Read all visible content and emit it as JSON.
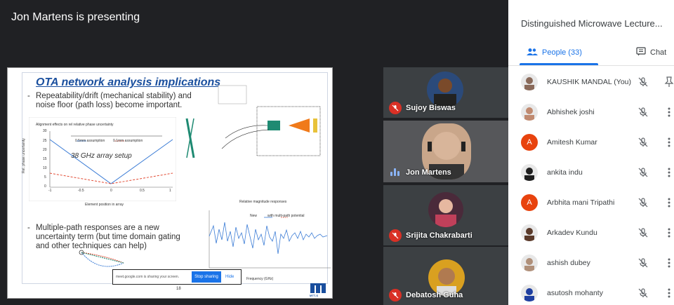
{
  "stage": {
    "presenting_label": "Jon Martens is presenting"
  },
  "slide": {
    "title": "OTA network analysis implications",
    "bullet1": "Repeatability/drift (mechanical stability) and noise floor (path loss) become important.",
    "bullet2": "Multiple-path responses are a new uncertainty term (but time domain gating and other techniques can help)",
    "chart1": {
      "title": "Alignment effects on rel relative phase uncertainty",
      "overlay": "38 GHz array setup",
      "legend_solid": "0.5mm assumption",
      "legend_dashed": "0.1mm assumption",
      "ylabel": "Rel. phase uncertainty",
      "xlabel": "Element position in array",
      "yticks": [
        "30",
        "25",
        "20",
        "15",
        "10",
        "5",
        "0"
      ],
      "xticks": [
        "-1",
        "-0.5",
        "0",
        "0.5",
        "1"
      ]
    },
    "chart2": {
      "title": "Relative magnitude responses",
      "legend_new": "New",
      "legend_mp": "with multi-path potential",
      "xlabel": "Frequency (GHz)"
    },
    "page_number": "18",
    "logo_text": "MTT-S"
  },
  "sharebar": {
    "message": "meet.google.com is sharing your screen.",
    "stop_label": "Stop sharing",
    "hide_label": "Hide"
  },
  "tiles": [
    {
      "name": "Sujoy Biswas",
      "muted": true
    },
    {
      "name": "Jon Martens",
      "muted": false
    },
    {
      "name": "Srijita Chakrabarti",
      "muted": true
    },
    {
      "name": "Debatosh Guha",
      "muted": true
    }
  ],
  "panel": {
    "title": "Distinguished Microwave Lecture...",
    "tab_people": "People (33)",
    "tab_chat": "Chat",
    "colors": {
      "accent": "#1a73e8",
      "letter_avatar": "#e8430e"
    },
    "people": [
      {
        "name": "KAUSHIK MANDAL (You)",
        "avatar": "photo"
      },
      {
        "name": "Abhishek joshi",
        "avatar": "photo"
      },
      {
        "name": "Amitesh Kumar",
        "avatar": "letter",
        "letter": "A"
      },
      {
        "name": "ankita indu",
        "avatar": "photo"
      },
      {
        "name": "Arbhita mani Tripathi",
        "avatar": "letter",
        "letter": "A"
      },
      {
        "name": "Arkadev Kundu",
        "avatar": "photo"
      },
      {
        "name": "ashish dubey",
        "avatar": "photo"
      },
      {
        "name": "asutosh mohanty",
        "avatar": "photo"
      }
    ]
  }
}
